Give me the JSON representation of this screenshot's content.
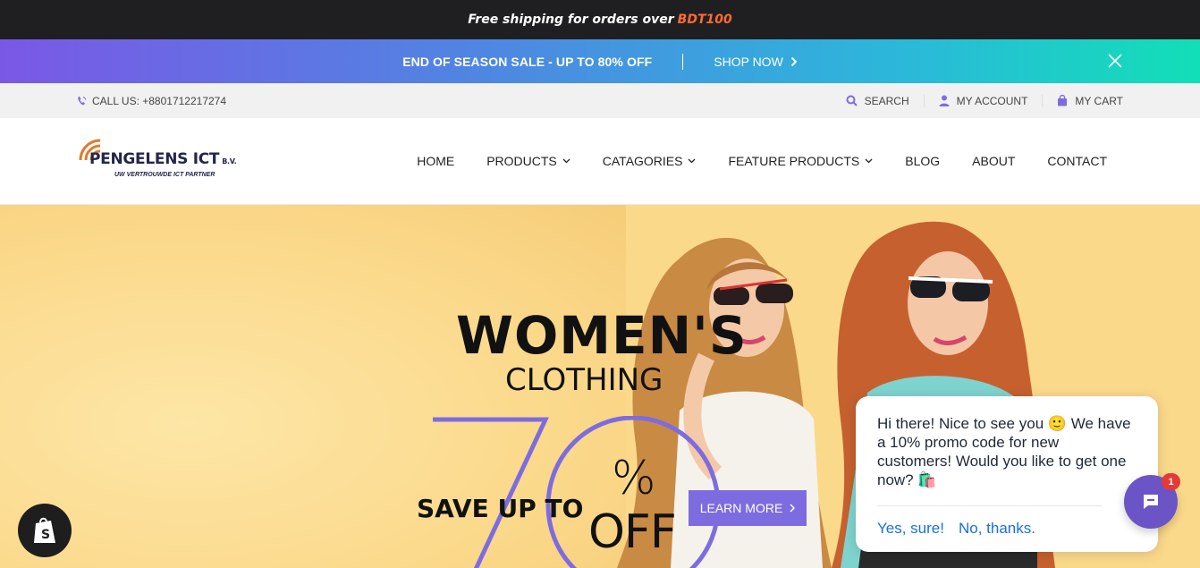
{
  "topbar": {
    "text": "Free shipping for orders over",
    "amount": "BDT100"
  },
  "salebar": {
    "text": "END OF SEASON SALE - UP TO 80% OFF",
    "cta": "SHOP NOW"
  },
  "utility": {
    "call": "CALL US: +8801712217274",
    "search": "SEARCH",
    "account": "MY ACCOUNT",
    "cart": "MY CART"
  },
  "logo": {
    "brand": "PENGELENS ICT",
    "suffix": "B.V.",
    "tagline": "UW VERTROUWDE ICT PARTNER"
  },
  "nav": {
    "items": [
      {
        "label": "HOME",
        "dropdown": false
      },
      {
        "label": "PRODUCTS",
        "dropdown": true
      },
      {
        "label": "CATAGORIES",
        "dropdown": true
      },
      {
        "label": "FEATURE PRODUCTS",
        "dropdown": true
      },
      {
        "label": "BLOG",
        "dropdown": false
      },
      {
        "label": "ABOUT",
        "dropdown": false
      },
      {
        "label": "CONTACT",
        "dropdown": false
      }
    ]
  },
  "hero": {
    "line1": "WOMEN'S",
    "line2": "CLOTHING",
    "save": "SAVE UP TO",
    "big_number": "70",
    "percent": "%",
    "off": "OFF",
    "cta": "LEARN MORE"
  },
  "chat": {
    "message": "Hi there! Nice to see you 🙂 We have a 10% promo code for new customers! Would you like to get one now? 🛍️",
    "yes": "Yes, sure!",
    "no": "No, thanks.",
    "badge": "1"
  },
  "colors": {
    "accent": "#7d6ce0",
    "amount": "#ff6a33",
    "hero_bg": "#fbd98b",
    "chat_launcher": "#6a54c6",
    "link": "#1a6ee6"
  },
  "icons": [
    "phone-icon",
    "search-icon",
    "user-icon",
    "bag-icon",
    "close-icon",
    "chevron-right-icon",
    "chevron-down-icon",
    "chat-icon",
    "shopify-icon"
  ]
}
